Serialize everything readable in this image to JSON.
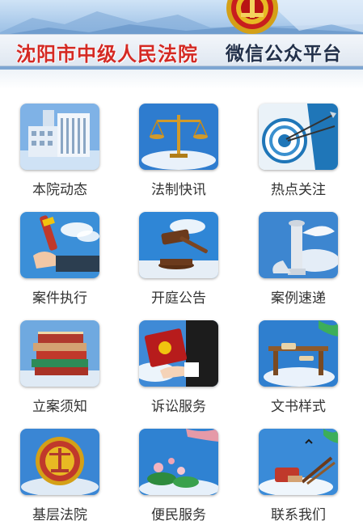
{
  "header": {
    "court_name": "沈阳市中级人民法院",
    "platform_name": "微信公众平台"
  },
  "menu": [
    {
      "label": "本院动态",
      "icon": "court-building-icon"
    },
    {
      "label": "法制快讯",
      "icon": "scales-of-justice-icon"
    },
    {
      "label": "热点关注",
      "icon": "target-darts-icon"
    },
    {
      "label": "案件执行",
      "icon": "hand-holding-gavel-icon"
    },
    {
      "label": "开庭公告",
      "icon": "gavel-icon"
    },
    {
      "label": "案例速递",
      "icon": "huabiao-pillar-icon"
    },
    {
      "label": "立案须知",
      "icon": "book-stack-icon"
    },
    {
      "label": "诉讼服务",
      "icon": "handshake-certificate-icon"
    },
    {
      "label": "文书样式",
      "icon": "scroll-gate-icon"
    },
    {
      "label": "基层法院",
      "icon": "court-emblem-icon"
    },
    {
      "label": "便民服务",
      "icon": "lotus-pond-icon"
    },
    {
      "label": "联系我们",
      "icon": "desk-inkstone-icon"
    }
  ],
  "colors": {
    "court_name": "#d42a24",
    "platform_name": "#22304a"
  }
}
